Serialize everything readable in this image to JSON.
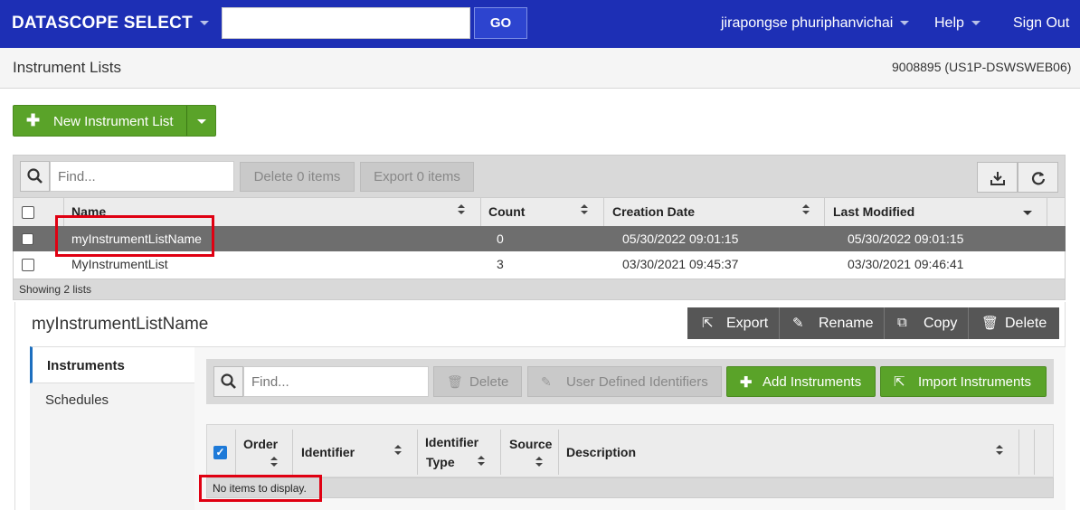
{
  "topbar": {
    "brand": "DATASCOPE SELECT",
    "search_value": "",
    "go_label": "GO",
    "user_name": "jirapongse phuriphanvichai",
    "help_label": "Help",
    "signout_label": "Sign Out"
  },
  "subheader": {
    "title": "Instrument Lists",
    "server_info": "9008895 (US1P-DSWSWEB06)"
  },
  "new_list_button": "New Instrument List",
  "list_toolbar": {
    "find_placeholder": "Find...",
    "delete_label": "Delete 0 items",
    "export_label": "Export 0 items"
  },
  "list_table": {
    "columns": [
      "Name",
      "Count",
      "Creation Date",
      "Last Modified"
    ],
    "rows": [
      {
        "name": "myInstrumentListName",
        "count": "0",
        "created": "05/30/2022 09:01:15",
        "modified": "05/30/2022 09:01:15",
        "selected": true
      },
      {
        "name": "MyInstrumentList",
        "count": "3",
        "created": "03/30/2021 09:45:37",
        "modified": "03/30/2021 09:46:41",
        "selected": false
      }
    ],
    "footer": "Showing 2 lists"
  },
  "detail": {
    "title": "myInstrumentListName",
    "actions": {
      "export": "Export",
      "rename": "Rename",
      "copy": "Copy",
      "delete": "Delete"
    },
    "tabs": [
      "Instruments",
      "Schedules"
    ],
    "toolbar": {
      "find_placeholder": "Find...",
      "delete_label": "Delete",
      "udi_label": "User Defined Identifiers",
      "add_label": "Add Instruments",
      "import_label": "Import Instruments"
    },
    "columns": {
      "order": "Order",
      "identifier": "Identifier",
      "identifier_type_1": "Identifier",
      "identifier_type_2": "Type",
      "source": "Source",
      "description": "Description"
    },
    "empty_message": "No items to display."
  },
  "colors": {
    "nav_blue": "#1d2fb5",
    "accent_green": "#5aa329",
    "selected_row": "#6e6e6e",
    "highlight_red": "#e00012"
  }
}
